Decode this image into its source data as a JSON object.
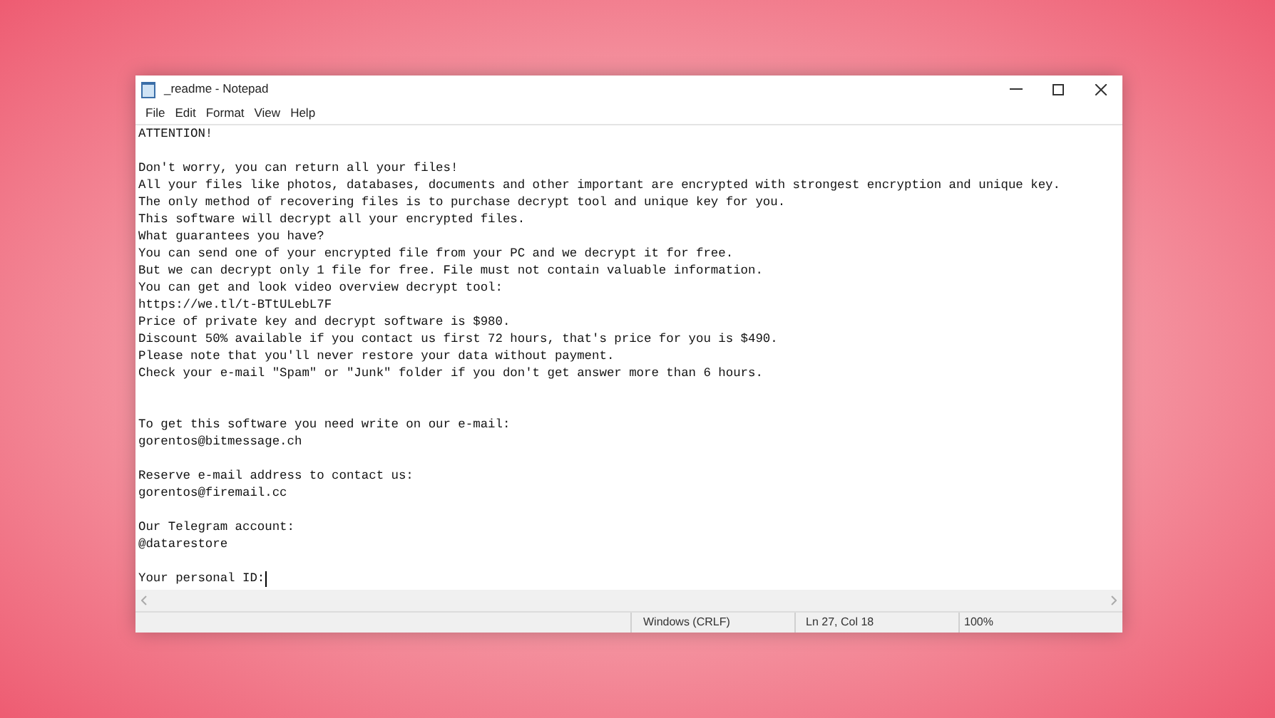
{
  "window": {
    "title": "_readme - Notepad"
  },
  "menu": [
    "File",
    "Edit",
    "Format",
    "View",
    "Help"
  ],
  "editor": {
    "blocks": [
      {
        "kind": "paragraph",
        "caret": false,
        "lines": [
          "ATTENTION!"
        ]
      },
      {
        "kind": "paragraph",
        "caret": false,
        "lines": [
          "Don't worry, you can return all your files!",
          "All your files like photos, databases, documents and other important are encrypted with strongest encryption and unique key.",
          "The only method of recovering files is to purchase decrypt tool and unique key for you.",
          "This software will decrypt all your encrypted files.",
          "What guarantees you have?",
          "You can send one of your encrypted file from your PC and we decrypt it for free.",
          "But we can decrypt only 1 file for free. File must not contain valuable information.",
          "You can get and look video overview decrypt tool:",
          "https://we.tl/t-BTtULebL7F",
          "Price of private key and decrypt software is $980.",
          "Discount 50% available if you contact us first 72 hours, that's price for you is $490.",
          "Please note that you'll never restore your data without payment.",
          "Check your e-mail \"Spam\" or \"Junk\" folder if you don't get answer more than 6 hours."
        ]
      },
      {
        "kind": "section",
        "caret": false,
        "lines": [
          "To get this software you need write on our e-mail:",
          "gorentos@bitmessage.ch"
        ]
      },
      {
        "kind": "paragraph",
        "caret": false,
        "lines": [
          "Reserve e-mail address to contact us:",
          "gorentos@firemail.cc"
        ]
      },
      {
        "kind": "paragraph",
        "caret": false,
        "lines": [
          "Our Telegram account:",
          "@datarestore"
        ]
      },
      {
        "kind": "paragraph",
        "caret": true,
        "lines": [
          "Your personal ID:"
        ]
      }
    ]
  },
  "status_bar": {
    "line_ending": "Windows (CRLF)",
    "position": "Ln 27, Col 18",
    "zoom": "100%"
  }
}
